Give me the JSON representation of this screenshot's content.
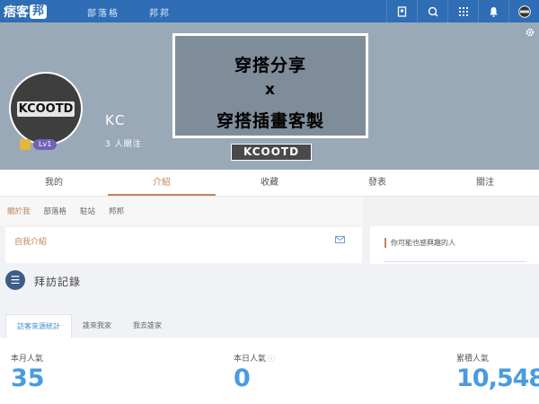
{
  "topbar": {
    "logo_text": "痞客",
    "logo_box": "邦",
    "nav": [
      "部落格",
      "邦邦"
    ],
    "icons": [
      "bookmark-icon",
      "search-icon",
      "apps-grid-icon",
      "bell-icon",
      "profile-menu-icon"
    ]
  },
  "banner": {
    "avatar_text": "KCOOTD",
    "level": "Lv1",
    "username": "KC",
    "followers": "3 人關注",
    "poster_line1": "穿搭分享",
    "poster_line2": "x",
    "poster_line3": "穿搭插畫客製",
    "poster_tag": "KCOOTD"
  },
  "tabs": [
    "我的",
    "介紹",
    "收藏",
    "發表",
    "關注"
  ],
  "submenu": [
    "關於我",
    "部落格",
    "駐站",
    "邦邦"
  ],
  "about": {
    "title": "自我介紹"
  },
  "side": {
    "title": "你可能也感興趣的人"
  },
  "visits": {
    "title": "拜訪記錄",
    "tabs": [
      "訪客來源統計",
      "誰來我家",
      "我去誰家"
    ],
    "stats": [
      {
        "label": "本月人氣",
        "value": "35"
      },
      {
        "label": "本日人氣",
        "value": "0"
      },
      {
        "label": "累積人氣",
        "value": "10,548"
      }
    ]
  },
  "colors": {
    "topbar": "#2f6db5",
    "accent": "#c48456",
    "stat": "#4a9be0"
  }
}
